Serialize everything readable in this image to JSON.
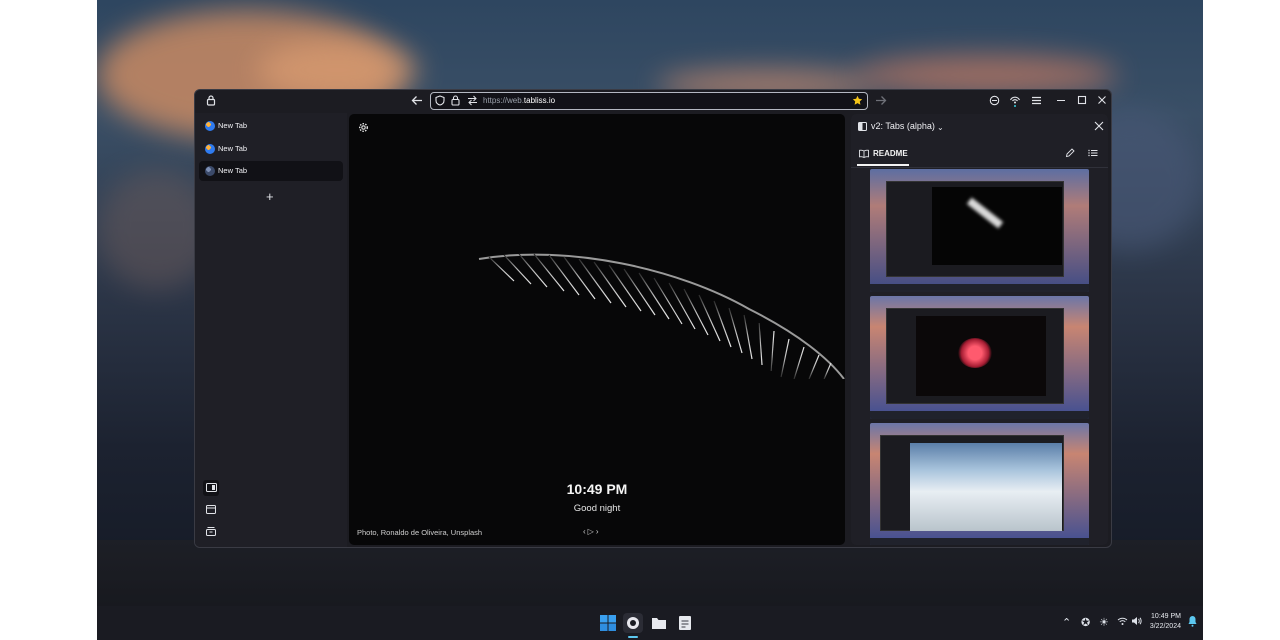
{
  "browser": {
    "url_prefix": "https://web.",
    "url_domain": "tabliss.io"
  },
  "tabs": [
    {
      "label": "New Tab"
    },
    {
      "label": "New Tab"
    },
    {
      "label": "New Tab"
    }
  ],
  "new_tab_symbol": "+",
  "tabliss": {
    "time": "10:49 PM",
    "greeting": "Good night",
    "credit": "Photo, Ronaldo de Oliveira, Unsplash"
  },
  "side_panel": {
    "title": "v2: Tabs (alpha)",
    "tab_label": "README"
  },
  "taskbar": {
    "time": "10:49 PM",
    "date": "3/22/2024"
  },
  "icons": [
    "lock-icon",
    "back-icon",
    "shield-icon",
    "padlock-icon",
    "permissions-icon",
    "star-icon",
    "forward-icon",
    "extensions-icon",
    "visibility-icon",
    "menu-icon",
    "minimize-icon",
    "maximize-icon",
    "close-icon",
    "gear-icon",
    "sidebar-toggle-icon",
    "window-icon",
    "archive-icon",
    "book-icon",
    "pencil-icon",
    "list-icon",
    "windows-start-icon",
    "folder-icon",
    "notification-icon"
  ]
}
